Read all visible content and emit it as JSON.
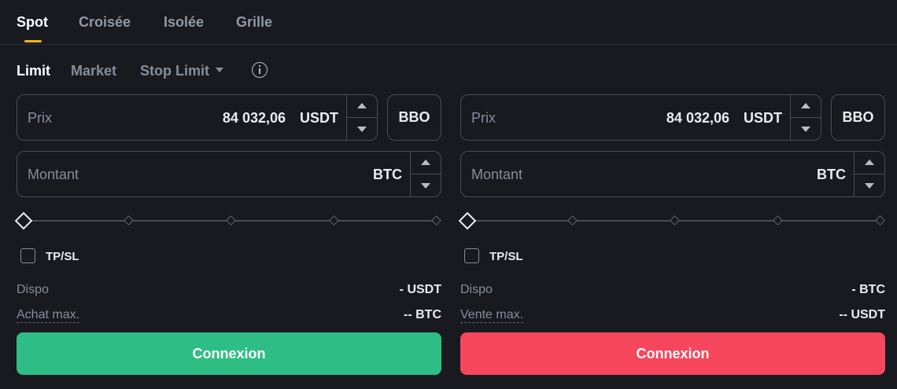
{
  "tabs": [
    "Spot",
    "Croisée",
    "Isolée",
    "Grille"
  ],
  "order_types": {
    "limit": "Limit",
    "market": "Market",
    "stop_limit": "Stop Limit"
  },
  "buy": {
    "price_label": "Prix",
    "price_value": "84 032,06",
    "price_unit": "USDT",
    "bbo_label": "BBO",
    "amount_label": "Montant",
    "amount_unit": "BTC",
    "tpsl_label": "TP/SL",
    "dispo_label": "Dispo",
    "dispo_value": "- USDT",
    "max_label": "Achat max.",
    "max_value": "-- BTC",
    "button_label": "Connexion"
  },
  "sell": {
    "price_label": "Prix",
    "price_value": "84 032,06",
    "price_unit": "USDT",
    "bbo_label": "BBO",
    "amount_label": "Montant",
    "amount_unit": "BTC",
    "tpsl_label": "TP/SL",
    "dispo_label": "Dispo",
    "dispo_value": "- BTC",
    "max_label": "Vente max.",
    "max_value": "-- USDT",
    "button_label": "Connexion"
  },
  "colors": {
    "accent": "#f0b90b",
    "buy": "#2ebd85",
    "sell": "#f6465d",
    "background": "#181a20"
  }
}
